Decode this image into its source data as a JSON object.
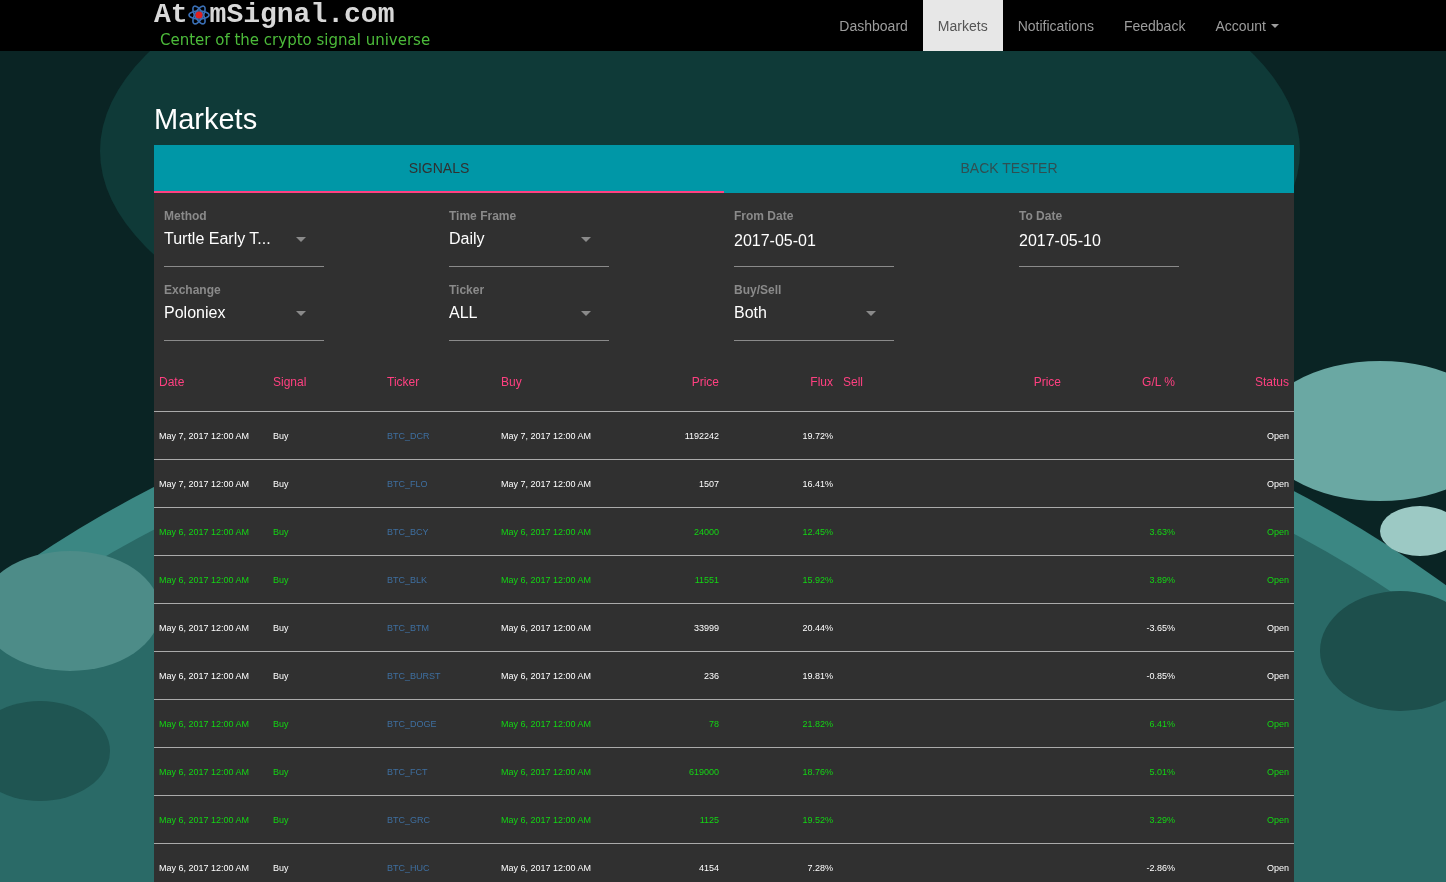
{
  "brand": {
    "logo_parts": [
      "At",
      "mSignal.com"
    ],
    "tagline": "Center of the crypto signal universe"
  },
  "nav": [
    {
      "label": "Dashboard",
      "selected": false,
      "dropdown": false
    },
    {
      "label": "Markets",
      "selected": true,
      "dropdown": false
    },
    {
      "label": "Notifications",
      "selected": false,
      "dropdown": false
    },
    {
      "label": "Feedback",
      "selected": false,
      "dropdown": false
    },
    {
      "label": "Account",
      "selected": false,
      "dropdown": true
    }
  ],
  "page_title": "Markets",
  "tabs": [
    {
      "label": "SIGNALS",
      "selected": true
    },
    {
      "label": "BACK TESTER",
      "selected": false
    }
  ],
  "filters": [
    [
      {
        "label": "Method",
        "value": "Turtle Early T...",
        "kind": "select"
      },
      {
        "label": "Time Frame",
        "value": "Daily",
        "kind": "select"
      },
      {
        "label": "From Date",
        "value": "2017-05-01",
        "kind": "date"
      },
      {
        "label": "To Date",
        "value": "2017-05-10",
        "kind": "date"
      }
    ],
    [
      {
        "label": "Exchange",
        "value": "Poloniex",
        "kind": "select"
      },
      {
        "label": "Ticker",
        "value": "ALL",
        "kind": "select"
      },
      {
        "label": "Buy/Sell",
        "value": "Both",
        "kind": "select"
      }
    ]
  ],
  "table": {
    "columns": [
      "Date",
      "Signal",
      "Ticker",
      "Buy",
      "Price",
      "Flux",
      "Sell",
      "Price",
      "G/L %",
      "Status"
    ],
    "rows": [
      {
        "highlighted": false,
        "cells": [
          "May 7, 2017 12:00 AM",
          "Buy",
          "BTC_DCR",
          "May 7, 2017 12:00 AM",
          "1192242",
          "19.72%",
          "",
          "",
          "",
          "Open"
        ]
      },
      {
        "highlighted": false,
        "cells": [
          "May 7, 2017 12:00 AM",
          "Buy",
          "BTC_FLO",
          "May 7, 2017 12:00 AM",
          "1507",
          "16.41%",
          "",
          "",
          "",
          "Open"
        ]
      },
      {
        "highlighted": true,
        "cells": [
          "May 6, 2017 12:00 AM",
          "Buy",
          "BTC_BCY",
          "May 6, 2017 12:00 AM",
          "24000",
          "12.45%",
          "",
          "",
          "3.63%",
          "Open"
        ]
      },
      {
        "highlighted": true,
        "cells": [
          "May 6, 2017 12:00 AM",
          "Buy",
          "BTC_BLK",
          "May 6, 2017 12:00 AM",
          "11551",
          "15.92%",
          "",
          "",
          "3.89%",
          "Open"
        ]
      },
      {
        "highlighted": false,
        "cells": [
          "May 6, 2017 12:00 AM",
          "Buy",
          "BTC_BTM",
          "May 6, 2017 12:00 AM",
          "33999",
          "20.44%",
          "",
          "",
          "-3.65%",
          "Open"
        ]
      },
      {
        "highlighted": false,
        "cells": [
          "May 6, 2017 12:00 AM",
          "Buy",
          "BTC_BURST",
          "May 6, 2017 12:00 AM",
          "236",
          "19.81%",
          "",
          "",
          "-0.85%",
          "Open"
        ]
      },
      {
        "highlighted": true,
        "cells": [
          "May 6, 2017 12:00 AM",
          "Buy",
          "BTC_DOGE",
          "May 6, 2017 12:00 AM",
          "78",
          "21.82%",
          "",
          "",
          "6.41%",
          "Open"
        ]
      },
      {
        "highlighted": true,
        "cells": [
          "May 6, 2017 12:00 AM",
          "Buy",
          "BTC_FCT",
          "May 6, 2017 12:00 AM",
          "619000",
          "18.76%",
          "",
          "",
          "5.01%",
          "Open"
        ]
      },
      {
        "highlighted": true,
        "cells": [
          "May 6, 2017 12:00 AM",
          "Buy",
          "BTC_GRC",
          "May 6, 2017 12:00 AM",
          "1125",
          "19.52%",
          "",
          "",
          "3.29%",
          "Open"
        ]
      },
      {
        "highlighted": false,
        "cells": [
          "May 6, 2017 12:00 AM",
          "Buy",
          "BTC_HUC",
          "May 6, 2017 12:00 AM",
          "4154",
          "7.28%",
          "",
          "",
          "-2.86%",
          "Open"
        ]
      }
    ]
  }
}
